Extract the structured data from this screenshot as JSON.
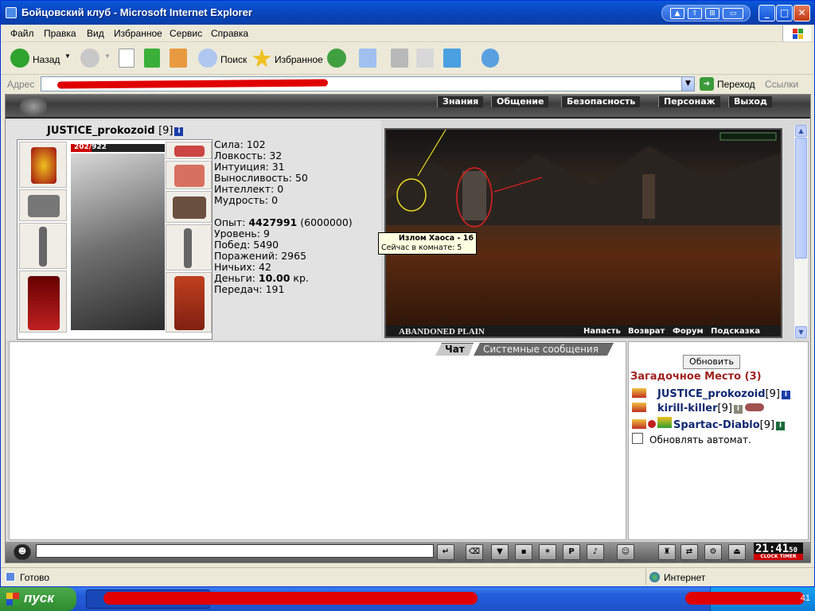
{
  "window": {
    "title": "Бойцовский клуб - Microsoft Internet Explorer",
    "min": "_",
    "max": "□",
    "close": "✕"
  },
  "menu": [
    "Файл",
    "Правка",
    "Вид",
    "Избранное",
    "Сервис",
    "Справка"
  ],
  "toolbar": {
    "back": "Назад",
    "search": "Поиск",
    "favorites": "Избранное"
  },
  "address": {
    "label": "Адрес",
    "go": "Переход",
    "links": "Ссылки"
  },
  "game_nav": [
    "Знания",
    "Общение",
    "Безопасность",
    "Персонаж",
    "Выход"
  ],
  "character": {
    "name": "JUSTICE_prokozoid",
    "level": "[9]",
    "hp_text": "202/922",
    "hp_fraction": 0.219,
    "stats": [
      {
        "label": "Сила:",
        "value": "102"
      },
      {
        "label": "Ловкость:",
        "value": "32"
      },
      {
        "label": "Интуиция:",
        "value": "31"
      },
      {
        "label": "Выносливость:",
        "value": "50"
      },
      {
        "label": "Интеллект:",
        "value": "0"
      },
      {
        "label": "Мудрость:",
        "value": "0"
      }
    ],
    "experience": {
      "label": "Опыт:",
      "value": "4427991",
      "next": "(6000000)"
    },
    "details": [
      {
        "label": "Уровень:",
        "value": "9"
      },
      {
        "label": "Побед:",
        "value": "5490"
      },
      {
        "label": "Поражений:",
        "value": "2965"
      },
      {
        "label": "Ничьих:",
        "value": "42"
      }
    ],
    "money": {
      "label": "Деньги:",
      "value": "10.00",
      "unit": "кр."
    },
    "transfers": {
      "label": "Передач:",
      "value": "191"
    }
  },
  "map": {
    "location": "ABANDONED PLAIN",
    "actions": [
      "Напасть",
      "Возврат",
      "Форум",
      "Подсказка"
    ],
    "tooltip": {
      "title": "Излом Хаоса - 16",
      "subtitle": "Сейчас в комнате: 5"
    }
  },
  "chat": {
    "tabs": [
      "Чат",
      "Системные сообщения"
    ]
  },
  "room": {
    "refresh": "Обновить",
    "title": "Загадочное Место (3)",
    "users": [
      {
        "name": "JUSTICE_prokozoid",
        "level": "[9]"
      },
      {
        "name": "kirill-killer",
        "level": "[9]"
      },
      {
        "name": "Spartac-Diablo",
        "level": "[9]"
      }
    ],
    "auto_refresh": "Обновлять автомат."
  },
  "bottombar": {
    "clock": "21:41",
    "clock_sec": "50",
    "clock_label": "CLOCK TIMER"
  },
  "status": {
    "text": "Готово",
    "zone": "Интернет"
  },
  "taskbar": {
    "start": "пуск",
    "time": "41"
  }
}
